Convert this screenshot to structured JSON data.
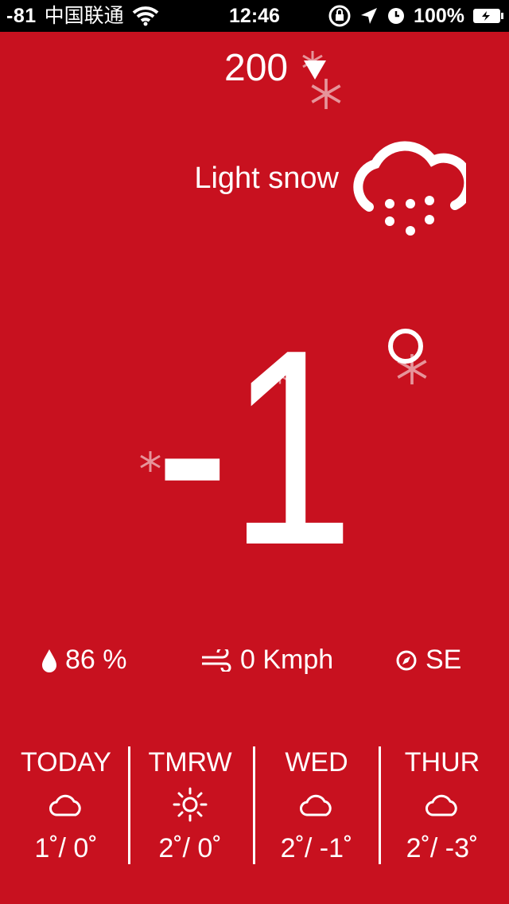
{
  "status_bar": {
    "signal": "-81",
    "carrier": "中国联通",
    "time": "12:46",
    "battery": "100%"
  },
  "aqi": {
    "value": "200"
  },
  "current": {
    "condition": "Light snow",
    "temperature": "-1",
    "humidity": "86 %",
    "wind": "0 Kmph",
    "direction": "SE"
  },
  "forecast": [
    {
      "day": "TODAY",
      "icon": "cloud-icon",
      "temp": "1˚/ 0˚"
    },
    {
      "day": "TMRW",
      "icon": "sun-icon",
      "temp": "2˚/ 0˚"
    },
    {
      "day": "WED",
      "icon": "cloud-icon",
      "temp": "2˚/ -1˚"
    },
    {
      "day": "THUR",
      "icon": "cloud-icon",
      "temp": "2˚/ -3˚"
    }
  ],
  "colors": {
    "background": "#c8111f",
    "foreground": "#ffffff"
  }
}
